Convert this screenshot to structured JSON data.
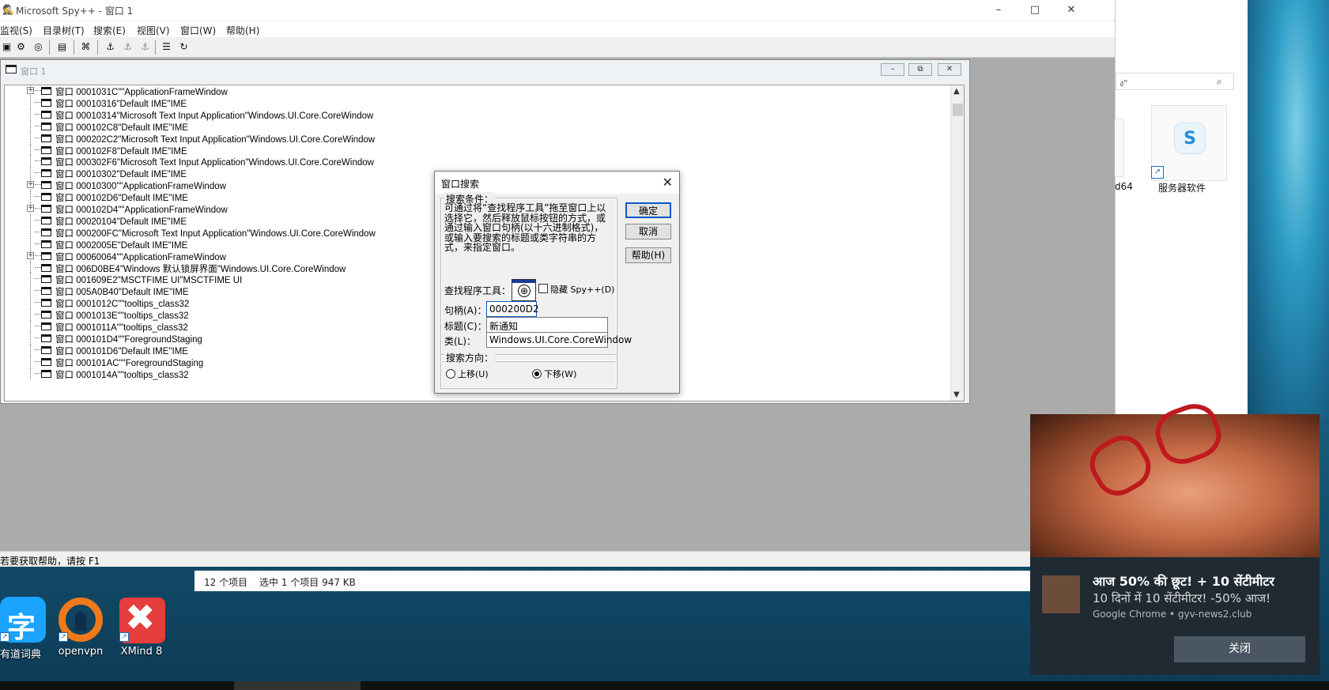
{
  "spy": {
    "title": "Microsoft Spy++ - 窗口 1",
    "menus": [
      "监视(S)",
      "目录树(T)",
      "搜索(E)",
      "视图(V)",
      "窗口(W)",
      "帮助(H)"
    ],
    "child_title": "窗口 1",
    "tree_rows": [
      {
        "text": "窗口 0001031C\"\"ApplicationFrameWindow",
        "expand": true
      },
      {
        "text": "窗口 00010316\"Default IME\"IME",
        "expand": false
      },
      {
        "text": "窗口 00010314\"Microsoft Text Input Application\"Windows.UI.Core.CoreWindow",
        "expand": false
      },
      {
        "text": "窗口 000102C8\"Default IME\"IME",
        "expand": false
      },
      {
        "text": "窗口 000202C2\"Microsoft Text Input Application\"Windows.UI.Core.CoreWindow",
        "expand": false
      },
      {
        "text": "窗口 000102F8\"Default IME\"IME",
        "expand": false
      },
      {
        "text": "窗口 000302F6\"Microsoft Text Input Application\"Windows.UI.Core.CoreWindow",
        "expand": false
      },
      {
        "text": "窗口 00010302\"Default IME\"IME",
        "expand": false
      },
      {
        "text": "窗口 00010300\"\"ApplicationFrameWindow",
        "expand": true
      },
      {
        "text": "窗口 000102D6\"Default IME\"IME",
        "expand": false
      },
      {
        "text": "窗口 000102D4\"\"ApplicationFrameWindow",
        "expand": true
      },
      {
        "text": "窗口 00020104\"Default IME\"IME",
        "expand": false
      },
      {
        "text": "窗口 000200FC\"Microsoft Text Input Application\"Windows.UI.Core.CoreWindow",
        "expand": false
      },
      {
        "text": "窗口 0002005E\"Default IME\"IME",
        "expand": false
      },
      {
        "text": "窗口 00060064\"\"ApplicationFrameWindow",
        "expand": true
      },
      {
        "text": "窗口 006D0BE4\"Windows 默认锁屏界面\"Windows.UI.Core.CoreWindow",
        "expand": false
      },
      {
        "text": "窗口 001609E2\"MSCTFIME UI\"MSCTFIME UI",
        "expand": false
      },
      {
        "text": "窗口 005A0B40\"Default IME\"IME",
        "expand": false
      },
      {
        "text": "窗口 0001012C\"\"tooltips_class32",
        "expand": false
      },
      {
        "text": "窗口 0001013E\"\"tooltips_class32",
        "expand": false
      },
      {
        "text": "窗口 0001011A\"\"tooltips_class32",
        "expand": false
      },
      {
        "text": "窗口 000101D4\"\"ForegroundStaging",
        "expand": false
      },
      {
        "text": "窗口 000101D6\"Default IME\"IME",
        "expand": false
      },
      {
        "text": "窗口 000101AC\"\"ForegroundStaging",
        "expand": false
      },
      {
        "text": "窗口 0001014A\"\"tooltips_class32",
        "expand": false
      }
    ],
    "status": "若要获取帮助，请按 F1"
  },
  "dialog": {
    "title": "窗口搜索",
    "criteria_label": "搜索条件：",
    "description": "可通过将“查找程序工具”拖至窗口上以选择它，然后释放鼠标按钮的方式，或通过输入窗口句柄(以十六进制格式)，或输入要搜索的标题或类字符串的方式，来指定窗口。",
    "ok": "确定",
    "cancel": "取消",
    "help": "帮助(H)",
    "finder_label": "查找程序工具：",
    "hide_label": "隐藏 Spy++(D)",
    "handle_label": "句柄(A)：",
    "handle_value": "000200D2",
    "caption_label": "标题(C)：",
    "caption_value": "新通知",
    "class_label": "类(L)：",
    "class_value": "Windows.UI.Core.CoreWindow",
    "direction_label": "搜索方向：",
    "up_label": "上移(U)",
    "down_label": "下移(W)"
  },
  "explorer": {
    "search_placeholder": "ง\"",
    "item_count": "12 个项目",
    "selected": "选中 1 个项目  947 KB",
    "tile_label": "服务器软件",
    "partial_label": "d64"
  },
  "desktop": {
    "icons": [
      {
        "label": "有道词典",
        "color": "#1aa3ff"
      },
      {
        "label": "openvpn",
        "color": "#f07a1a"
      },
      {
        "label": "XMind 8",
        "color": "#e63d3d"
      }
    ]
  },
  "toast": {
    "title": "आज 50% की छूट! + 10 सेंटीमीटर",
    "subtitle": "10 दिनों में 10 सेंटीमीटर! -50% आज!",
    "source": "Google Chrome • gyv-news2.club",
    "close": "关闭"
  }
}
